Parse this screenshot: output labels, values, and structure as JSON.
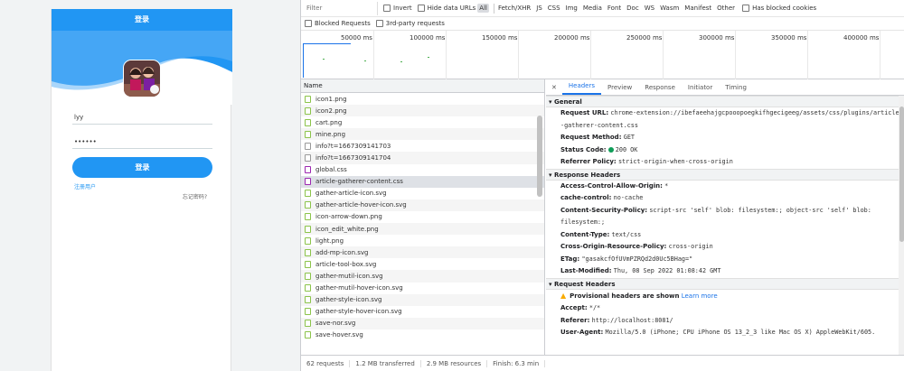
{
  "app": {
    "header_title": "登录",
    "username_value": "lyy",
    "password_value": "••••••",
    "login_button": "登录",
    "register_link": "注册用户",
    "forgot_link": "忘记密码?"
  },
  "devtools": {
    "filter_placeholder": "Filter",
    "toolbar1": {
      "invert": "Invert",
      "hide_data_urls": "Hide data URLs",
      "types": [
        "All",
        "Fetch/XHR",
        "JS",
        "CSS",
        "Img",
        "Media",
        "Font",
        "Doc",
        "WS",
        "Wasm",
        "Manifest",
        "Other"
      ],
      "has_blocked_cookies": "Has blocked cookies"
    },
    "toolbar2": {
      "blocked_requests": "Blocked Requests",
      "third_party": "3rd-party requests"
    },
    "timeline_ticks": [
      "50000 ms",
      "100000 ms",
      "150000 ms",
      "200000 ms",
      "250000 ms",
      "300000 ms",
      "350000 ms",
      "400000 ms"
    ],
    "list_header": "Name",
    "requests": [
      {
        "name": "icon1.png",
        "type": "img"
      },
      {
        "name": "icon2.png",
        "type": "img"
      },
      {
        "name": "cart.png",
        "type": "img"
      },
      {
        "name": "mine.png",
        "type": "img"
      },
      {
        "name": "info?t=1667309141703",
        "type": "doc"
      },
      {
        "name": "info?t=1667309141704",
        "type": "doc"
      },
      {
        "name": "global.css",
        "type": "css"
      },
      {
        "name": "article-gatherer-content.css",
        "type": "css"
      },
      {
        "name": "gather-article-icon.svg",
        "type": "img"
      },
      {
        "name": "gather-article-hover-icon.svg",
        "type": "img"
      },
      {
        "name": "icon-arrow-down.png",
        "type": "img"
      },
      {
        "name": "icon_edit_white.png",
        "type": "img"
      },
      {
        "name": "light.png",
        "type": "img"
      },
      {
        "name": "add-mp-icon.svg",
        "type": "img"
      },
      {
        "name": "article-tool-box.svg",
        "type": "img"
      },
      {
        "name": "gather-mutil-icon.svg",
        "type": "img"
      },
      {
        "name": "gather-mutil-hover-icon.svg",
        "type": "img"
      },
      {
        "name": "gather-style-icon.svg",
        "type": "img"
      },
      {
        "name": "gather-style-hover-icon.svg",
        "type": "img"
      },
      {
        "name": "save-nor.svg",
        "type": "img"
      },
      {
        "name": "save-hover.svg",
        "type": "img"
      }
    ],
    "status": {
      "requests": "62 requests",
      "transferred": "1.2 MB transferred",
      "resources": "2.9 MB resources",
      "finish": "Finish: 6.3 min"
    },
    "detail_tabs": [
      "Headers",
      "Preview",
      "Response",
      "Initiator",
      "Timing"
    ],
    "general": {
      "title": "General",
      "rows": [
        {
          "k": "Request URL:",
          "v": "chrome-extension://ibefaeehajgcpooopoegkifhgecigeeg/assets/css/plugins/article-gatherer-content.css"
        },
        {
          "k": "Request Method:",
          "v": "GET"
        },
        {
          "k": "Status Code:",
          "v": "200 OK"
        },
        {
          "k": "Referrer Policy:",
          "v": "strict-origin-when-cross-origin"
        }
      ]
    },
    "response_headers": {
      "title": "Response Headers",
      "rows": [
        {
          "k": "Access-Control-Allow-Origin:",
          "v": "*"
        },
        {
          "k": "cache-control:",
          "v": "no-cache"
        },
        {
          "k": "Content-Security-Policy:",
          "v": "script-src 'self' blob: filesystem:; object-src 'self' blob: filesystem:;"
        },
        {
          "k": "Content-Type:",
          "v": "text/css"
        },
        {
          "k": "Cross-Origin-Resource-Policy:",
          "v": "cross-origin"
        },
        {
          "k": "ETag:",
          "v": "\"gasakcfOfUVmPZRQd2d0Uc5BHag=\""
        },
        {
          "k": "Last-Modified:",
          "v": "Thu, 08 Sep 2022 01:08:42 GMT"
        }
      ]
    },
    "request_headers": {
      "title": "Request Headers",
      "provisional": "Provisional headers are shown",
      "learn_more": "Learn more",
      "rows": [
        {
          "k": "Accept:",
          "v": "*/*"
        },
        {
          "k": "Referer:",
          "v": "http://localhost:8081/"
        },
        {
          "k": "User-Agent:",
          "v": "Mozilla/5.0 (iPhone; CPU iPhone OS 13_2_3 like Mac OS X) AppleWebKit/605."
        }
      ]
    }
  }
}
